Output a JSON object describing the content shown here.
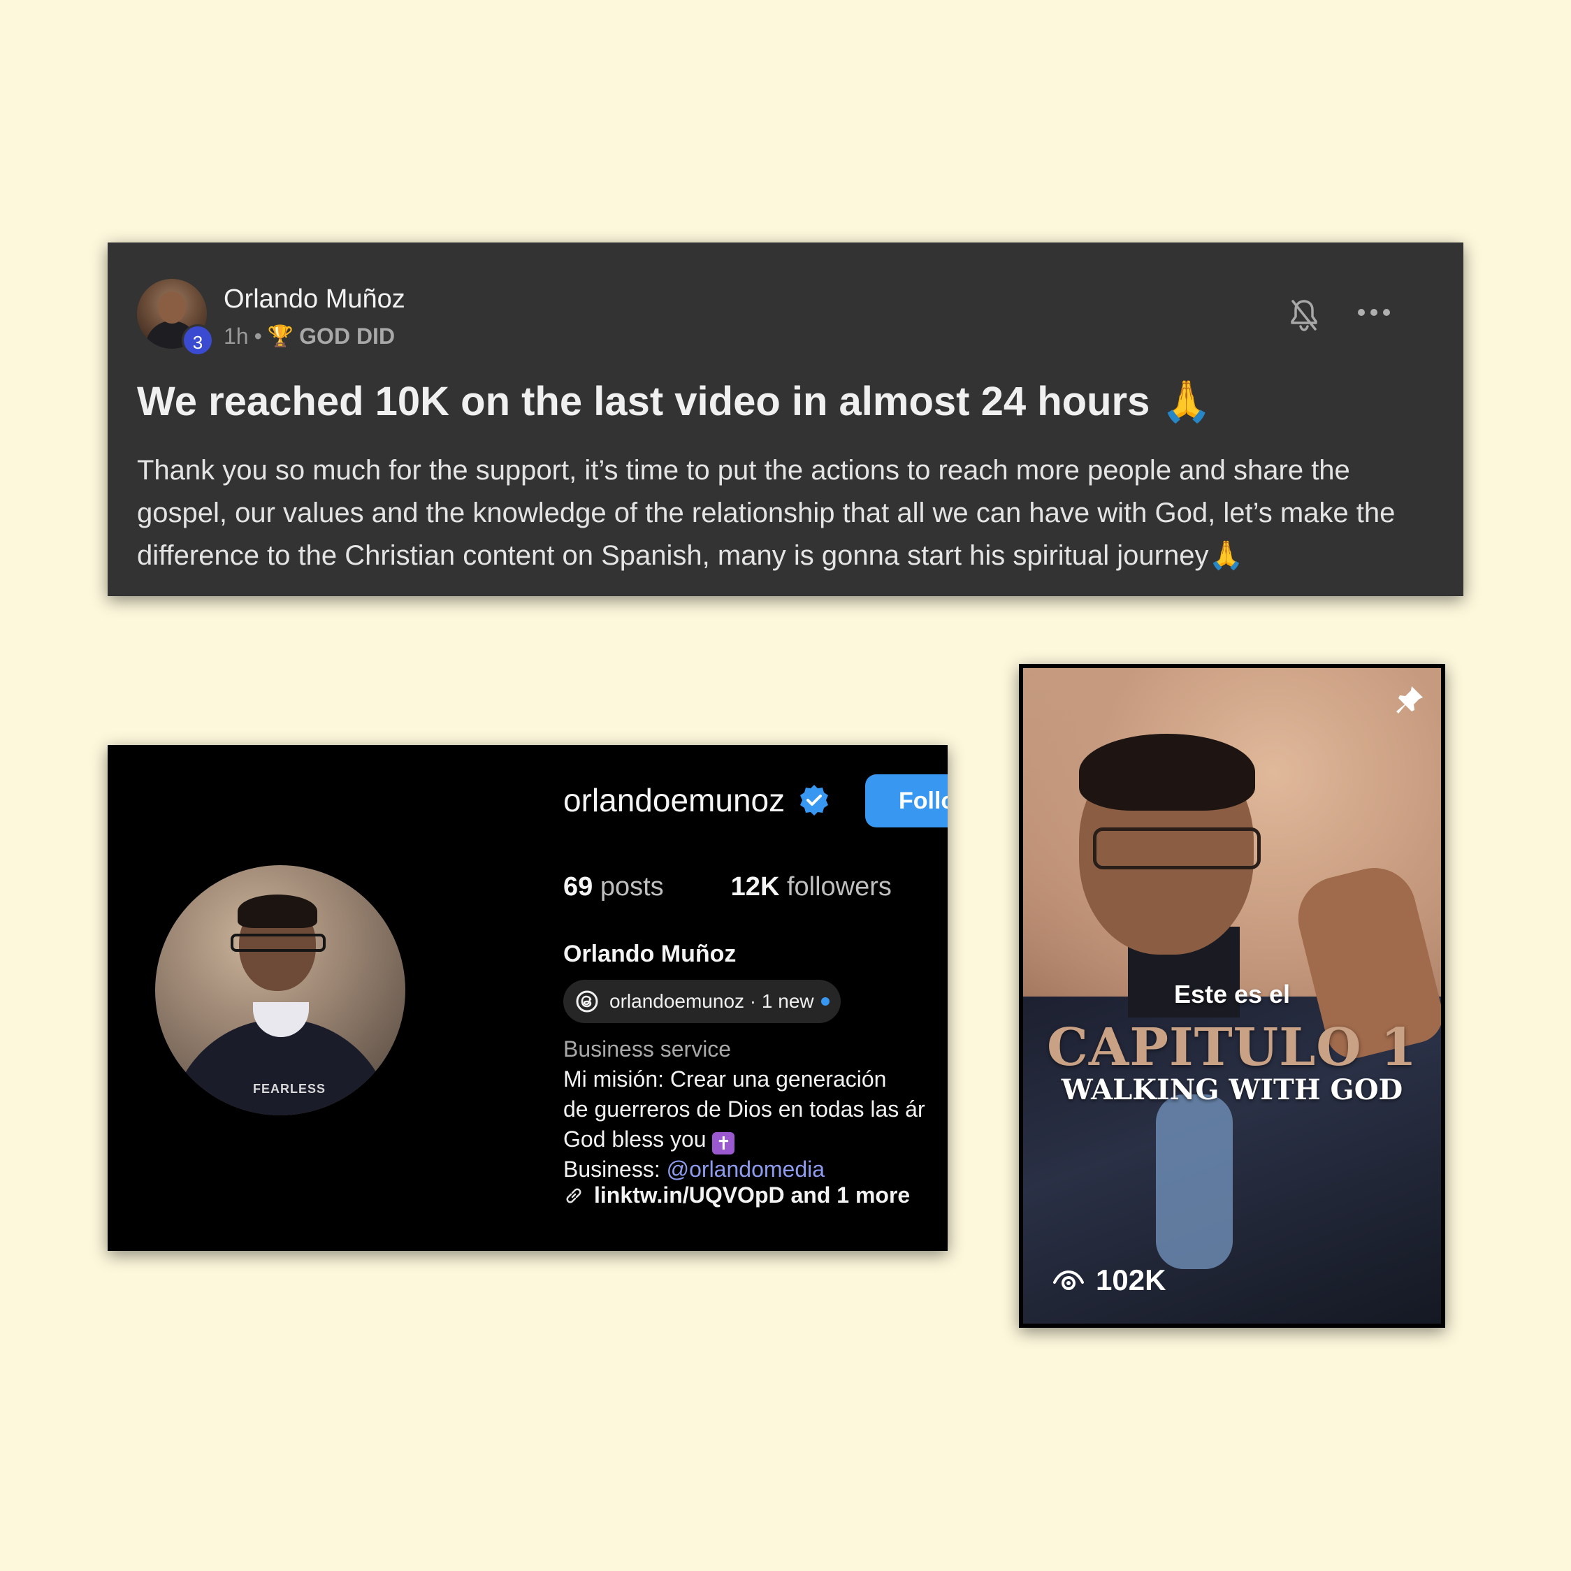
{
  "post": {
    "author": "Orlando Muñoz",
    "level": "3",
    "time": "1h",
    "separator": "•",
    "badge_label": "GOD DID",
    "icons": {
      "badge": "trophy-icon",
      "notify": "bell-off-icon",
      "menu": "more-horizontal-icon"
    },
    "title": "We reached 10K on the last video in almost 24 hours 🙏",
    "body": "Thank you so much for the support, it’s time to put the actions to reach more people and share the gospel, our values and the knowledge of the relationship that all we can have with God, let’s make the difference to the Christian content on Spanish, many is gonna start his spiritual journey🙏"
  },
  "profile": {
    "handle": "orlandoemunoz",
    "follow_label": "Follo",
    "posts_count": "69",
    "posts_label": "posts",
    "followers_count": "12K",
    "followers_label": "followers",
    "full_name": "Orlando Muñoz",
    "threads_label": "orlandoemunoz · 1 new",
    "category": "Business service",
    "bio_line1": "Mi misión: Crear una generación",
    "bio_line2": "de guerreros de Dios en todas las ár",
    "bio_line3": "God bless you",
    "bio_emoji": "✝",
    "business_label": "Business:",
    "business_mention": "@orlandomedia",
    "link_text": "linktw.in/UQVOpD and 1 more",
    "shirt_text": "FEARLESS",
    "colors": {
      "accent": "#3897f0",
      "mention": "#8e9cf0"
    }
  },
  "video": {
    "caption_small": "Este es el",
    "caption_big": "CAPITULO 1",
    "caption_mid": "WALKING WITH GOD",
    "views": "102K",
    "icons": {
      "pinned": "pin-icon",
      "views": "eye-icon"
    }
  }
}
